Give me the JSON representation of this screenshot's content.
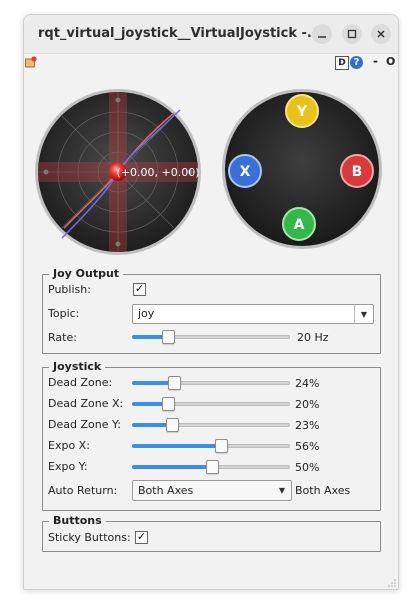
{
  "window": {
    "title": "rqt_virtual_joystick__VirtualJoystick -..."
  },
  "toolbar": {
    "d_label": "D",
    "help_label": "?",
    "dash_label": "-",
    "o_label": "O"
  },
  "joystick_view": {
    "position_text": "(+0.00, +0.00)"
  },
  "buttons_view": {
    "buttons": [
      {
        "label": "Y",
        "color": "#e8c21a"
      },
      {
        "label": "X",
        "color": "#3a6fd8"
      },
      {
        "label": "B",
        "color": "#d63a3a"
      },
      {
        "label": "A",
        "color": "#35b84a"
      }
    ]
  },
  "joy_output": {
    "title": "Joy Output",
    "publish_label": "Publish:",
    "publish_checked": true,
    "topic_label": "Topic:",
    "topic_value": "joy",
    "rate_label": "Rate:",
    "rate_value": "20 Hz",
    "rate_fraction": 0.2
  },
  "joystick": {
    "title": "Joystick",
    "rows": [
      {
        "label": "Dead Zone:",
        "value": "24%",
        "fraction": 0.24
      },
      {
        "label": "Dead Zone X:",
        "value": "20%",
        "fraction": 0.2
      },
      {
        "label": "Dead Zone Y:",
        "value": "23%",
        "fraction": 0.23
      },
      {
        "label": "Expo X:",
        "value": "56%",
        "fraction": 0.56
      },
      {
        "label": "Expo Y:",
        "value": "50%",
        "fraction": 0.5
      }
    ],
    "auto_return_label": "Auto Return:",
    "auto_return_value": "Both Axes",
    "auto_return_display": "Both Axes"
  },
  "buttons_group": {
    "title": "Buttons",
    "sticky_label": "Sticky Buttons:",
    "sticky_checked": true
  },
  "colors": {
    "accent": "#3d8ee6"
  }
}
